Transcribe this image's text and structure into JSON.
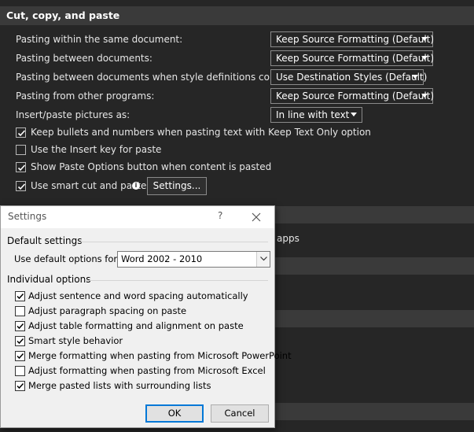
{
  "section": {
    "title": "Cut, copy, and paste"
  },
  "options": [
    {
      "label": "Pasting within the same document:",
      "value": "Keep Source Formatting (Default)"
    },
    {
      "label": "Pasting between documents:",
      "value": "Keep Source Formatting (Default)"
    },
    {
      "label": "Pasting between documents when style definitions conflict:",
      "value": "Use Destination Styles (Default)"
    },
    {
      "label": "Pasting from other programs:",
      "value": "Keep Source Formatting (Default)"
    },
    {
      "label": "Insert/paste pictures as:",
      "value": "In line with text"
    }
  ],
  "checkboxes": [
    {
      "label": "Keep bullets and numbers when pasting text with Keep Text Only option",
      "checked": true
    },
    {
      "label": "Use the Insert key for paste",
      "checked": false
    },
    {
      "label": "Show Paste Options button when content is pasted",
      "checked": true
    },
    {
      "label": "Use smart cut and paste",
      "checked": true
    }
  ],
  "settings_button": "Settings...",
  "background_fragment": "apps",
  "dialog": {
    "title": "Settings",
    "help": "?",
    "default_group": "Default settings",
    "default_label": "Use default options for:",
    "default_value": "Word 2002 - 2010",
    "individual_group": "Individual options",
    "items": [
      {
        "label": "Adjust sentence and word spacing automatically",
        "checked": true
      },
      {
        "label": "Adjust paragraph spacing on paste",
        "checked": false
      },
      {
        "label": "Adjust table formatting and alignment on paste",
        "checked": true
      },
      {
        "label": "Smart style behavior",
        "checked": true
      },
      {
        "label": "Merge formatting when pasting from Microsoft PowerPoint",
        "checked": true
      },
      {
        "label": "Adjust formatting when pasting from Microsoft Excel",
        "checked": false
      },
      {
        "label": "Merge pasted lists with surrounding lists",
        "checked": true
      }
    ],
    "ok": "OK",
    "cancel": "Cancel"
  }
}
